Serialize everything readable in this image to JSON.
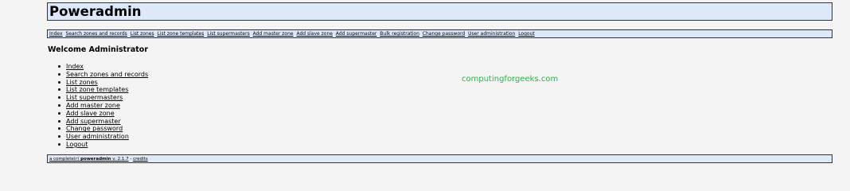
{
  "header": {
    "title": "Poweradmin"
  },
  "menu": {
    "items": [
      "Index",
      "Search zones and records",
      "List zones",
      "List zone templates",
      "List supermasters",
      "Add master zone",
      "Add slave zone",
      "Add supermaster",
      "Bulk registration",
      "Change password",
      "User administration",
      "Logout"
    ]
  },
  "main": {
    "welcome": "Welcome Administrator",
    "links": [
      "Index",
      "Search zones and records",
      "List zones",
      "List zone templates",
      "List supermasters",
      "Add master zone",
      "Add slave zone",
      "Add supermaster",
      "Change password",
      "User administration",
      "Logout"
    ]
  },
  "watermark": "computingforgeeks.com",
  "footer": {
    "prefix": "a complete(r) ",
    "app_name": "poweradmin",
    "version": " v. 2.1.7",
    "separator": " - ",
    "credits": "credits"
  },
  "colors": {
    "panel_bg": "#dde9f9",
    "page_bg": "#f4f4f4",
    "watermark": "#2bb34a"
  }
}
